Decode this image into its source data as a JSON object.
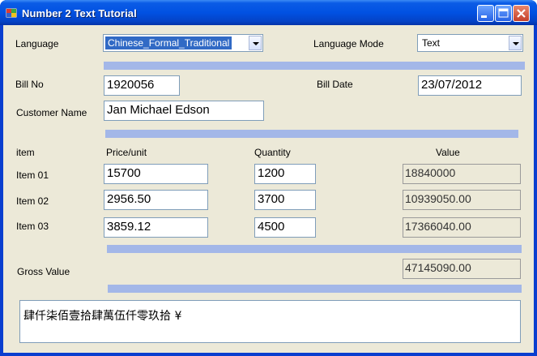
{
  "window": {
    "title": "Number 2 Text Tutorial"
  },
  "labels": {
    "language": "Language",
    "language_mode": "Language Mode",
    "bill_no": "Bill No",
    "bill_date": "Bill Date",
    "customer_name": "Customer Name",
    "item": "item",
    "price_unit": "Price/unit",
    "quantity": "Quantity",
    "value": "Value",
    "gross_value": "Gross Value"
  },
  "language": {
    "selected": "Chinese_Formal_Traditional"
  },
  "language_mode": {
    "selected": "Text"
  },
  "bill": {
    "no": "1920056",
    "date": "23/07/2012",
    "customer": "Jan Michael Edson"
  },
  "items": [
    {
      "label": "Item 01",
      "price": "15700",
      "quantity": "1200",
      "value": "18840000"
    },
    {
      "label": "Item 02",
      "price": "2956.50",
      "quantity": "3700",
      "value": "10939050.00"
    },
    {
      "label": "Item 03",
      "price": "3859.12",
      "quantity": "4500",
      "value": "17366040.00"
    }
  ],
  "gross_value": "47145090.00",
  "text_output": "肆仟柒佰壹拾肆萬伍仟零玖拾 ¥",
  "colors": {
    "titlebar": "#0151e2",
    "client": "#ece9d8",
    "separator": "#a3b7e8"
  }
}
